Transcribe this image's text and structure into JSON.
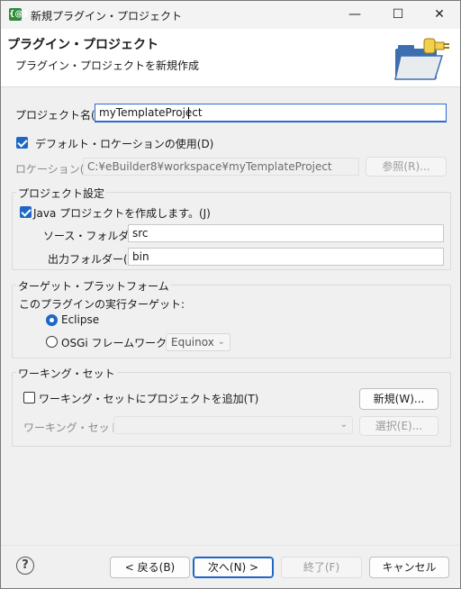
{
  "window": {
    "title": "新規プラグイン・プロジェクト",
    "app_icon": "{@}",
    "minimize_glyph": "—",
    "maximize_glyph": "☐",
    "close_glyph": "✕"
  },
  "header": {
    "title": "プラグイン・プロジェクト",
    "description": "プラグイン・プロジェクトを新規作成"
  },
  "project_name": {
    "label": "プロジェクト名(P):",
    "value": "myTemplateProject"
  },
  "default_location": {
    "label": "デフォルト・ロケーションの使用(D)",
    "checked": true
  },
  "location": {
    "label": "ロケーション(L):",
    "value": "C:¥eBuilder8¥workspace¥myTemplateProject",
    "browse_label": "参照(R)..."
  },
  "project_settings": {
    "group_title": "プロジェクト設定",
    "java_label": "Java プロジェクトを作成します。(J)",
    "source_folder_label": "ソース・フォルダ(S):",
    "source_folder_value": "src",
    "output_folder_label": "出力フォルダー(O):",
    "output_folder_value": "bin"
  },
  "target_platform": {
    "group_title": "ターゲット・プラットフォーム",
    "prompt": "このプラグインの実行ターゲット:",
    "eclipse_label": "Eclipse",
    "osgi_label": "OSGi フレームワーク(A):",
    "osgi_value": "Equinox"
  },
  "working_set": {
    "group_title": "ワーキング・セット",
    "add_label": "ワーキング・セットにプロジェクトを追加(T)",
    "new_label": "新規(W)...",
    "sets_label": "ワーキング・セット(O):",
    "sets_value": "",
    "select_label": "選択(E)..."
  },
  "footer": {
    "help_glyph": "?",
    "back_label": "< 戻る(B)",
    "next_label": "次へ(N) >",
    "finish_label": "終了(F)",
    "cancel_label": "キャンセル"
  },
  "colors": {
    "accent": "#1e67c6",
    "app_icon": "#2e8b3a"
  }
}
